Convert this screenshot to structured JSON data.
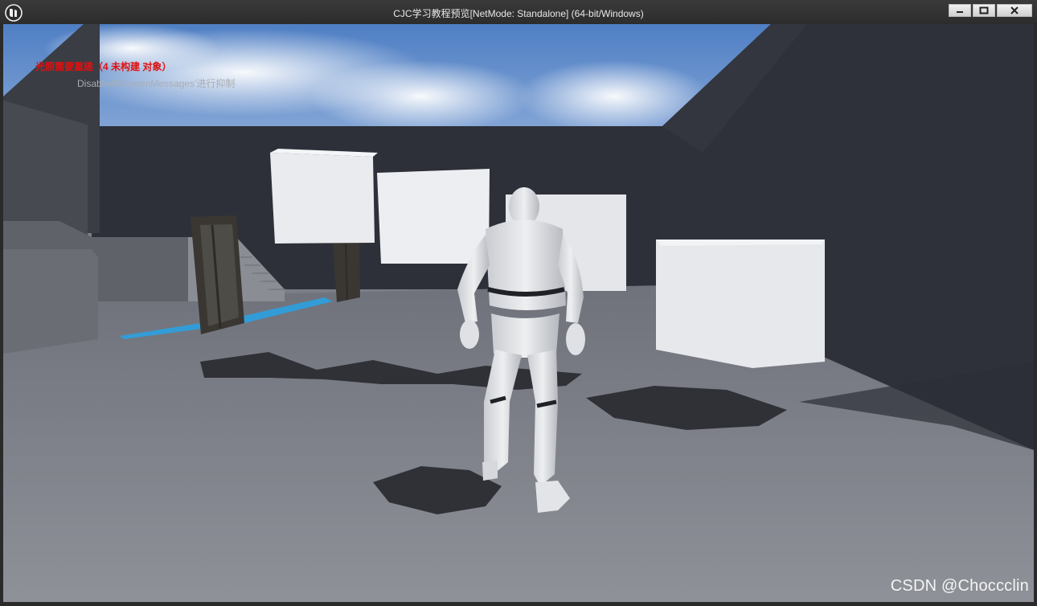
{
  "window": {
    "title": "CJC学习教程预览[NetMode: Standalone]  (64-bit/Windows)",
    "icons": {
      "logo": "unreal-logo-icon",
      "minimize": "minimize-icon",
      "maximize": "maximize-icon",
      "close": "close-icon"
    }
  },
  "viewport": {
    "messages": {
      "lighting_warning": "光照需要重建（4 未构建 对象）",
      "suppress_hint": "DisableAllScreenMessages'进行抑制"
    }
  },
  "watermark": "CSDN @Choccclin",
  "colors": {
    "warning": "#e01010",
    "hint": "#a9adb3",
    "sky": "#5b86c7"
  }
}
